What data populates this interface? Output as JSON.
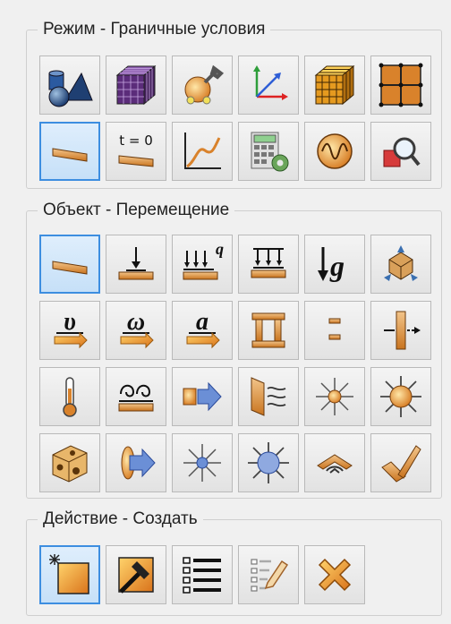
{
  "mode_group": {
    "title": "Режим - Граничные условия",
    "buttons": [
      {
        "icon": "geometry-shapes-icon"
      },
      {
        "icon": "mesh-cube-icon"
      },
      {
        "icon": "material-properties-icon"
      },
      {
        "icon": "coordinate-axes-icon"
      },
      {
        "icon": "mesh-grid-cube-icon"
      },
      {
        "icon": "mesh-elements-icon"
      },
      {
        "icon": "boundary-conditions-icon",
        "active": true
      },
      {
        "icon": "time-step-icon",
        "label": "t = 0"
      },
      {
        "icon": "function-curve-icon"
      },
      {
        "icon": "solver-settings-icon"
      },
      {
        "icon": "oscillation-icon"
      },
      {
        "icon": "results-inspect-icon"
      }
    ]
  },
  "object_group": {
    "title": "Объект - Перемещение",
    "buttons": [
      {
        "icon": "displacement-icon",
        "active": true
      },
      {
        "icon": "point-load-icon"
      },
      {
        "icon": "distributed-load-icon",
        "label": "q"
      },
      {
        "icon": "pressure-load-icon"
      },
      {
        "icon": "gravity-icon",
        "label": "g"
      },
      {
        "icon": "rigid-body-icon"
      },
      {
        "icon": "velocity-icon",
        "label": "υ"
      },
      {
        "icon": "angular-velocity-icon",
        "label": "ω"
      },
      {
        "icon": "acceleration-icon",
        "label": "a"
      },
      {
        "icon": "contact-icon"
      },
      {
        "icon": "gap-icon"
      },
      {
        "icon": "force-transfer-icon"
      },
      {
        "icon": "temperature-icon"
      },
      {
        "icon": "heat-source-icon"
      },
      {
        "icon": "heat-flux-icon"
      },
      {
        "icon": "convection-icon"
      },
      {
        "icon": "radiation-icon"
      },
      {
        "icon": "volume-radiation-icon"
      },
      {
        "icon": "body-heat-icon"
      },
      {
        "icon": "surface-flux-icon"
      },
      {
        "icon": "point-emission-icon"
      },
      {
        "icon": "volume-emission-icon"
      },
      {
        "icon": "angular-radiation-icon"
      },
      {
        "icon": "angle-icon"
      }
    ]
  },
  "action_group": {
    "title": "Действие - Создать",
    "buttons": [
      {
        "icon": "create-new-icon",
        "active": true
      },
      {
        "icon": "edit-hammer-icon"
      },
      {
        "icon": "list-icon"
      },
      {
        "icon": "edit-list-icon"
      },
      {
        "icon": "delete-icon"
      }
    ]
  },
  "colors": {
    "panel_bg": "#f0f0f0",
    "button_bg": "#e8e8e8",
    "active_border": "#3d8ee0",
    "active_bg": "#cde4fa",
    "icon_orange": "#d9822b",
    "icon_tan": "#e9b97a"
  }
}
